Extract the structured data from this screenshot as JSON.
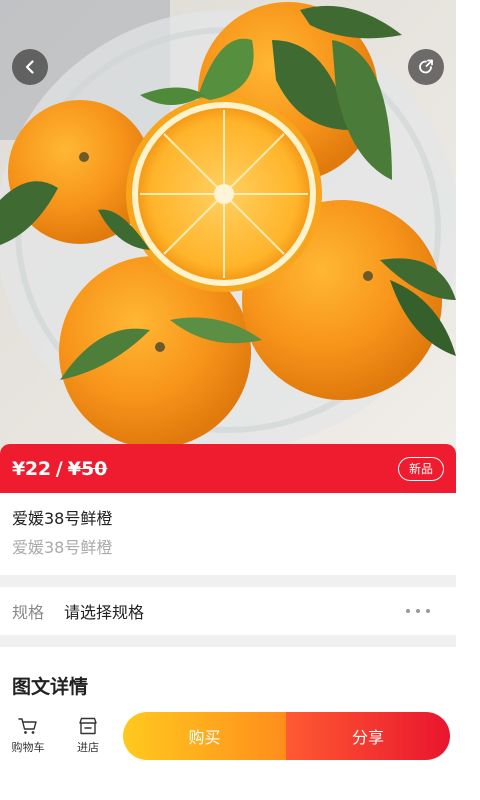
{
  "product": {
    "price": "¥22",
    "price_separator": "/",
    "original_price": "¥50",
    "badge": "新品",
    "title": "爱媛38号鲜橙",
    "subtitle": "爱媛38号鲜橙"
  },
  "spec": {
    "label": "规格",
    "value": "请选择规格"
  },
  "detail": {
    "title": "图文详情"
  },
  "bottom_bar": {
    "cart_label": "购物车",
    "shop_label": "进店",
    "buy_label": "购买",
    "share_label": "分享"
  },
  "colors": {
    "price_bar": "#ee1c2e",
    "buy_gradient": [
      "#ffc91e",
      "#ff8d1c"
    ],
    "share_gradient": [
      "#ff5a32",
      "#e9152e"
    ]
  },
  "icons": {
    "back": "chevron-left-icon",
    "share": "share-circle-icon",
    "more": "more-dots-icon",
    "cart": "cart-icon",
    "shop": "shop-icon"
  }
}
